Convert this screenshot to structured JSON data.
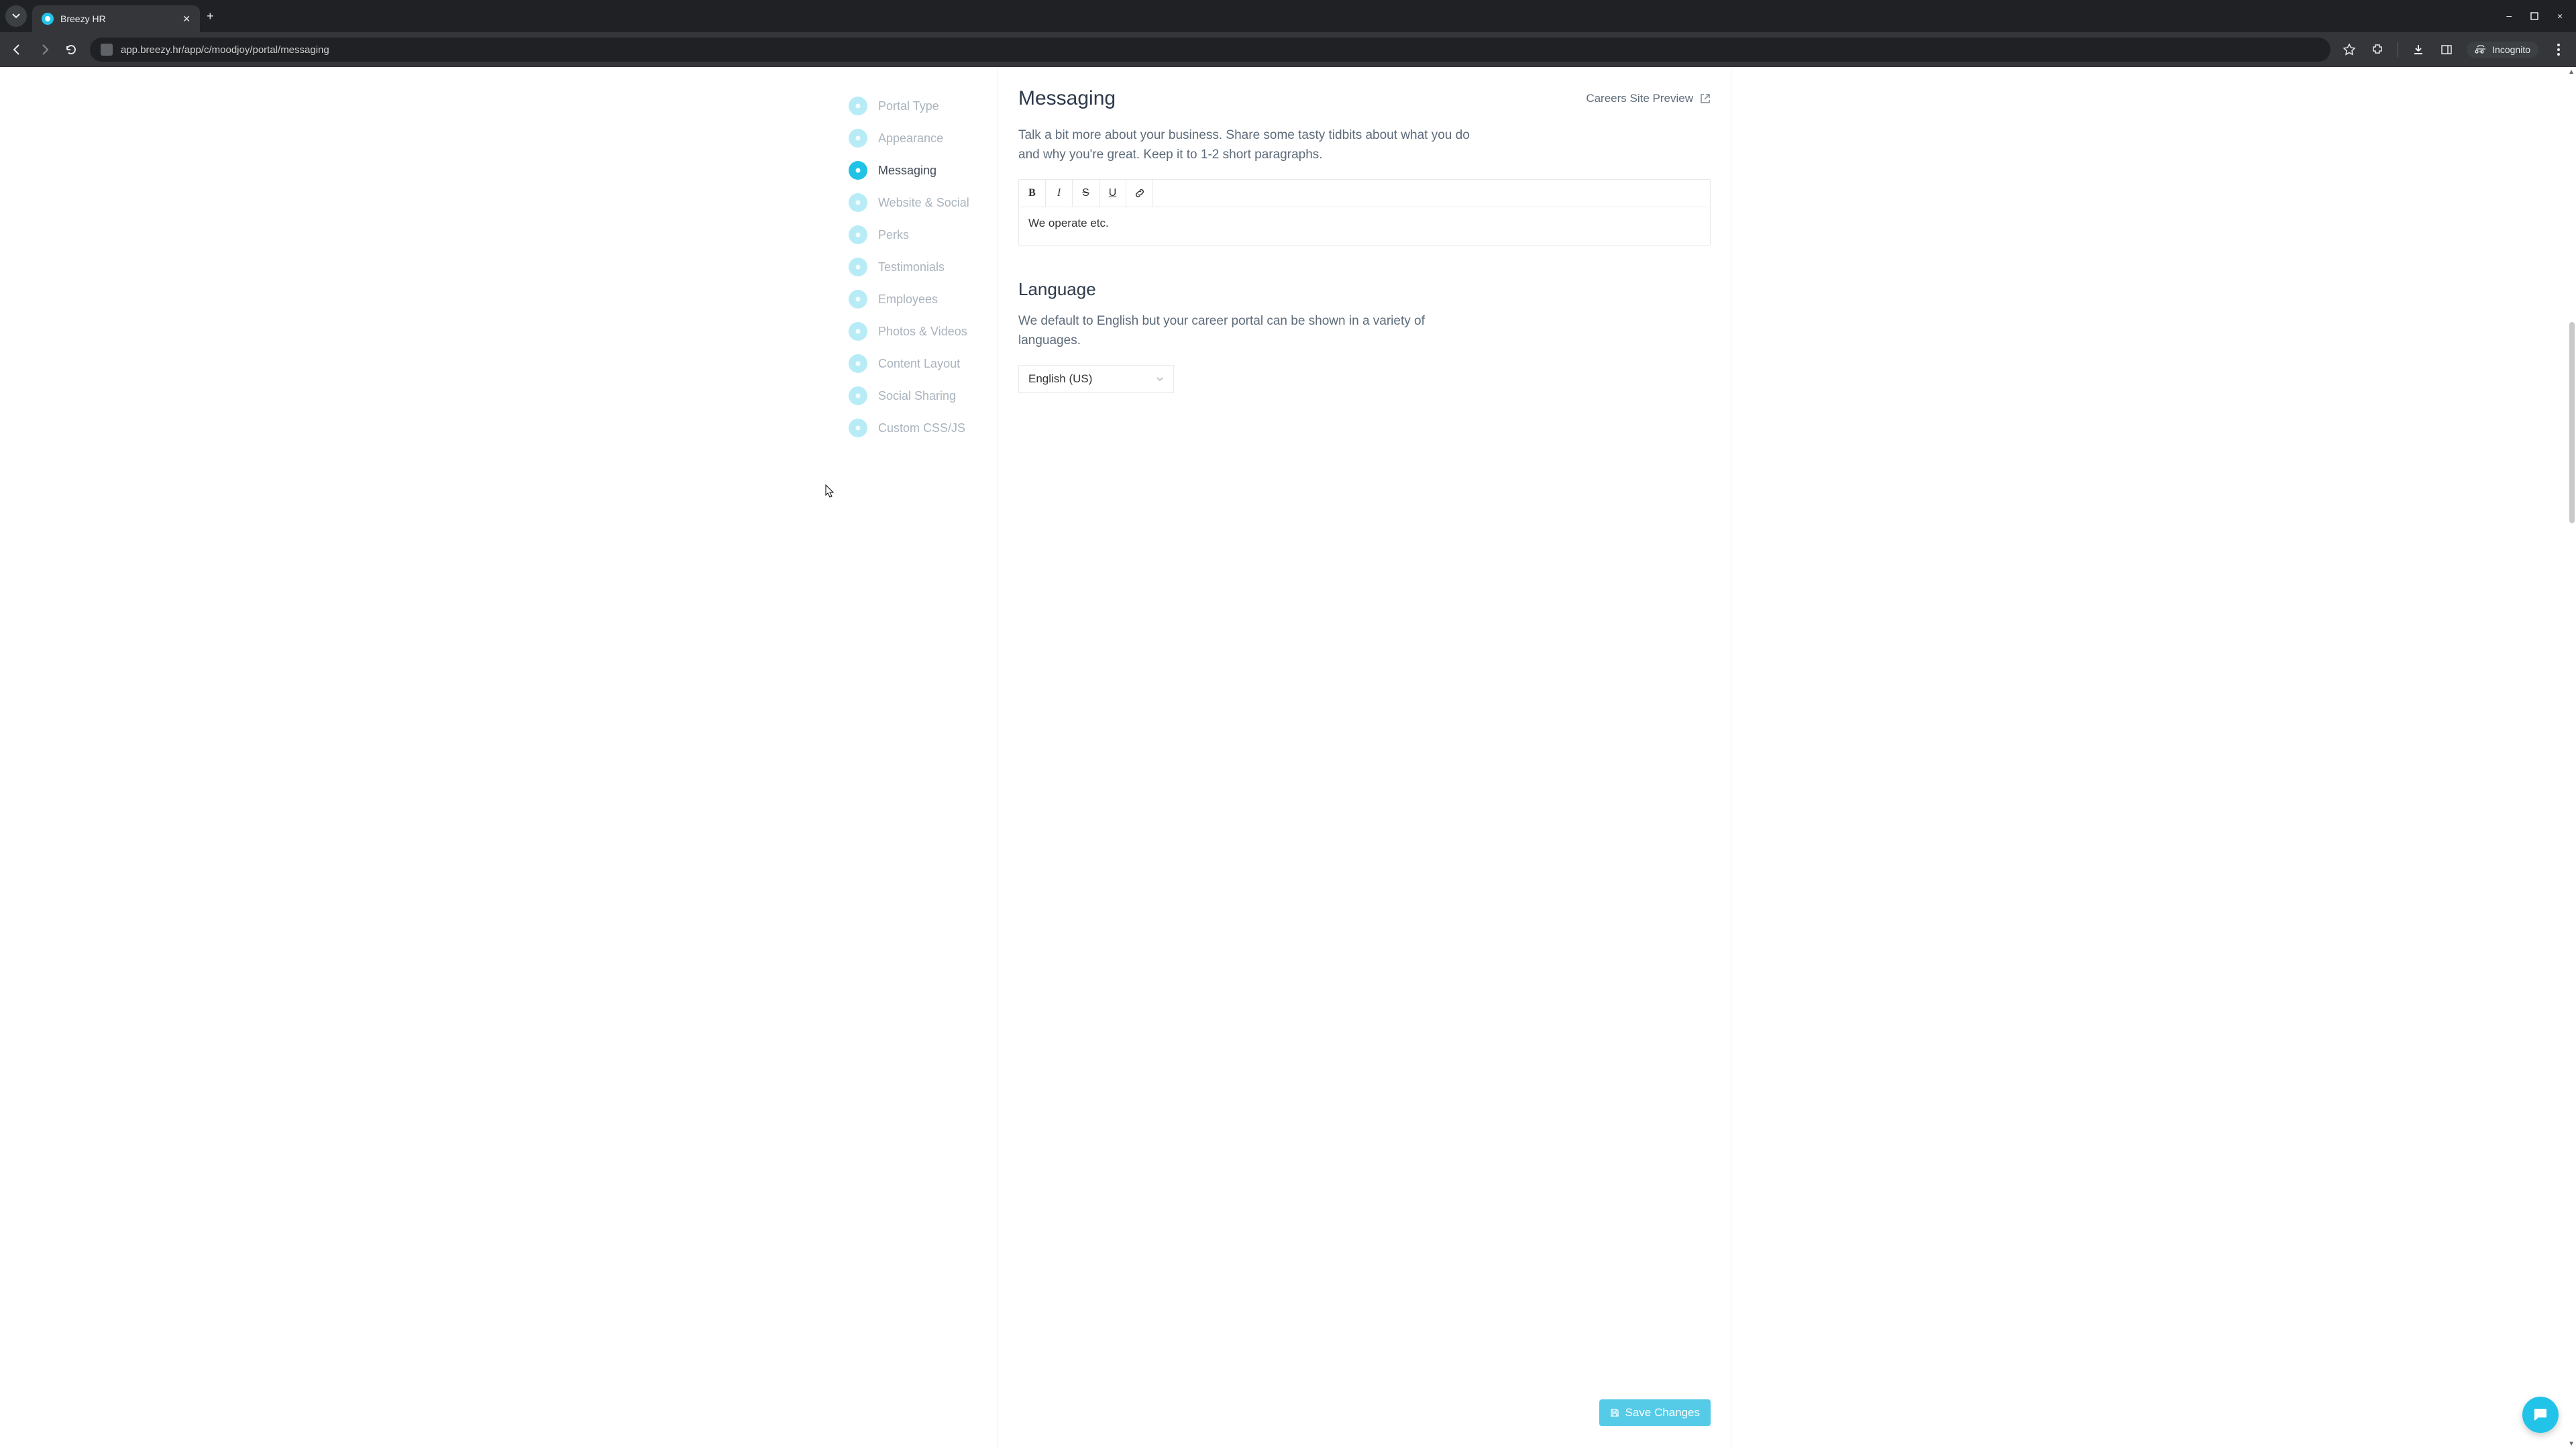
{
  "browser": {
    "tab_title": "Breezy HR",
    "url": "app.breezy.hr/app/c/moodjoy/portal/messaging",
    "incognito_label": "Incognito"
  },
  "sidebar": {
    "items": [
      {
        "label": "Portal Type",
        "icon": "layout-icon",
        "active": false
      },
      {
        "label": "Appearance",
        "icon": "brush-icon",
        "active": false
      },
      {
        "label": "Messaging",
        "icon": "chat-icon",
        "active": true
      },
      {
        "label": "Website & Social",
        "icon": "share-icon",
        "active": false
      },
      {
        "label": "Perks",
        "icon": "gift-icon",
        "active": false
      },
      {
        "label": "Testimonials",
        "icon": "quote-icon",
        "active": false
      },
      {
        "label": "Employees",
        "icon": "users-icon",
        "active": false
      },
      {
        "label": "Photos & Videos",
        "icon": "photo-icon",
        "active": false
      },
      {
        "label": "Content Layout",
        "icon": "grid-icon",
        "active": false
      },
      {
        "label": "Social Sharing",
        "icon": "globe-icon",
        "active": false
      },
      {
        "label": "Custom CSS/JS",
        "icon": "code-icon",
        "active": false
      }
    ]
  },
  "main": {
    "title": "Messaging",
    "preview_link": "Careers Site Preview",
    "desc_1": "Talk a bit more about your business. Share some tasty tidbits about what you do and why you're great. Keep it to 1-2 short paragraphs.",
    "editor_value": "We operate etc.",
    "lang_title": "Language",
    "lang_desc": "We default to English but your career portal can be shown in a variety of languages.",
    "lang_selected": "English (US)",
    "save_label": "Save Changes"
  }
}
